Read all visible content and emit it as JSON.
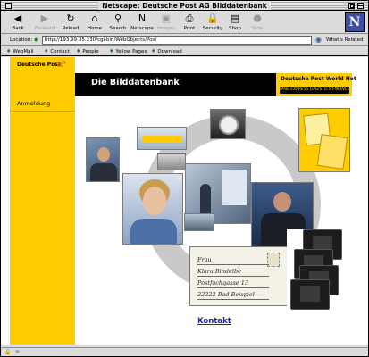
{
  "window": {
    "title": "Netscape: Deutsche Post AG Bilddatenbank"
  },
  "toolbar": {
    "buttons": [
      {
        "label": "Back",
        "icon": "back-arrow-icon",
        "glyph": "◀",
        "enabled": true
      },
      {
        "label": "Forward",
        "icon": "forward-arrow-icon",
        "glyph": "▶",
        "enabled": false
      },
      {
        "label": "Reload",
        "icon": "reload-icon",
        "glyph": "↻",
        "enabled": true
      },
      {
        "label": "Home",
        "icon": "home-icon",
        "glyph": "⌂",
        "enabled": true
      },
      {
        "label": "Search",
        "icon": "search-icon",
        "glyph": "⚲",
        "enabled": true
      },
      {
        "label": "Netscape",
        "icon": "netscape-icon",
        "glyph": "N",
        "enabled": true
      },
      {
        "label": "Images",
        "icon": "images-icon",
        "glyph": "▣",
        "enabled": false
      },
      {
        "label": "Print",
        "icon": "print-icon",
        "glyph": "⎙",
        "enabled": true
      },
      {
        "label": "Security",
        "icon": "lock-icon",
        "glyph": "🔒",
        "enabled": true
      },
      {
        "label": "Shop",
        "icon": "shop-icon",
        "glyph": "▤",
        "enabled": true
      },
      {
        "label": "Stop",
        "icon": "stop-icon",
        "glyph": "⬣",
        "enabled": false
      }
    ],
    "logo_letter": "N"
  },
  "location": {
    "label": "Location:",
    "url": "http://193.99.35.230/cgi-bin/WebObjects/Post",
    "related_label": "What's Related"
  },
  "personal_toolbar": {
    "items": [
      "WebMail",
      "Contact",
      "People",
      "Yellow Pages",
      "Download"
    ]
  },
  "page": {
    "brand": "Deutsche Post",
    "sidebar_link": "Anmeldung",
    "banner_title": "Die Bilddatenbank",
    "worldnet_name": "Deutsche Post",
    "worldnet_suffix": "World Net",
    "worldnet_tagline": "MAIL EXPRESS LOGISTICS FINANCE",
    "sign_text": "",
    "letter_lines": [
      "Frau",
      "Klara Bindelbe",
      "Postfachgasse 13",
      "22222 Bad Beispiel"
    ],
    "kontakt_link": "Kontakt"
  },
  "colors": {
    "brand_yellow": "#ffcc00",
    "banner_black": "#000000",
    "link_blue": "#1a2fa0"
  }
}
